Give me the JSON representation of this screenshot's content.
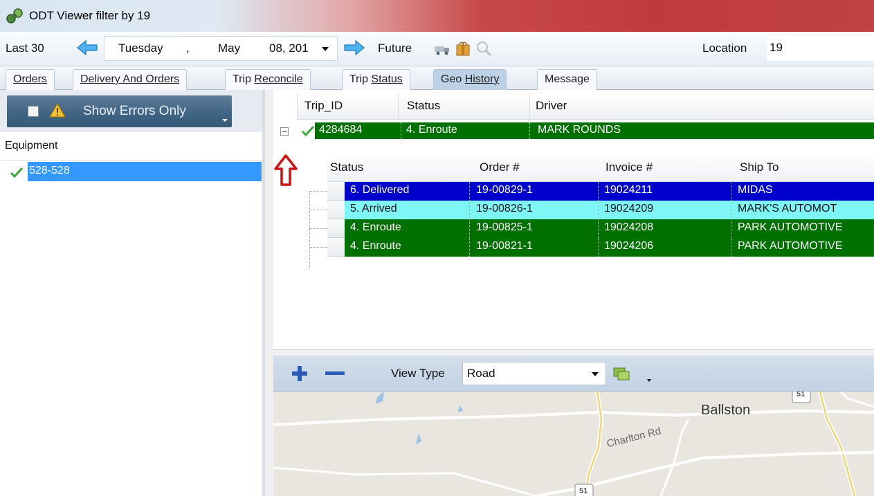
{
  "window": {
    "title": "ODT Viewer filter by 19"
  },
  "toolbar": {
    "last_label": "Last 30",
    "day": "Tuesday",
    "sep": ",",
    "month": "May",
    "date_rest": "08, 201",
    "future_label": "Future",
    "location_label": "Location",
    "location_value": "19"
  },
  "tabs": [
    {
      "pre": "",
      "u": "Orders",
      "post": ""
    },
    {
      "pre": "",
      "u": "Delivery And Orders",
      "post": ""
    },
    {
      "pre": "Trip ",
      "u": "Reconcile",
      "post": ""
    },
    {
      "pre": "Trip ",
      "u": "Status",
      "post": ""
    },
    {
      "pre": "Geo ",
      "u": "History",
      "post": ""
    },
    {
      "pre": "Message",
      "u": "",
      "post": ""
    }
  ],
  "left": {
    "show_errors_label": "Show Errors Only",
    "equipment_header": "Equipment",
    "equipment_item": "528-528"
  },
  "grid": {
    "headers": [
      "Trip_ID",
      "Status",
      "Driver"
    ],
    "trip": {
      "id": "4284684",
      "status": "4. Enroute",
      "driver": "MARK ROUNDS"
    },
    "sub_headers": [
      "Status",
      "Order #",
      "Invoice #",
      "Ship To"
    ],
    "sub_rows": [
      {
        "status": "6. Delivered",
        "order": "19-00829-1",
        "invoice": "19024211",
        "ship_to": "MIDAS",
        "bg": "#0000cc",
        "fg": "#ffffff"
      },
      {
        "status": "5. Arrived",
        "order": "19-00826-1",
        "invoice": "19024209",
        "ship_to": "MARK'S  AUTOMOT",
        "bg": "#7ff6f6",
        "fg": "#111111"
      },
      {
        "status": "4. Enroute",
        "order": "19-00825-1",
        "invoice": "19024208",
        "ship_to": "PARK AUTOMOTIVE",
        "bg": "#007000",
        "fg": "#ffffff"
      },
      {
        "status": "4. Enroute",
        "order": "19-00821-1",
        "invoice": "19024206",
        "ship_to": "PARK AUTOMOTIVE",
        "bg": "#007000",
        "fg": "#ffffff"
      }
    ]
  },
  "map_toolbar": {
    "view_type_label": "View Type",
    "view_type_value": "Road"
  },
  "map": {
    "place_label": "Ballston",
    "road_label": "Charlton Rd",
    "route_1": "51",
    "route_2": "51"
  }
}
